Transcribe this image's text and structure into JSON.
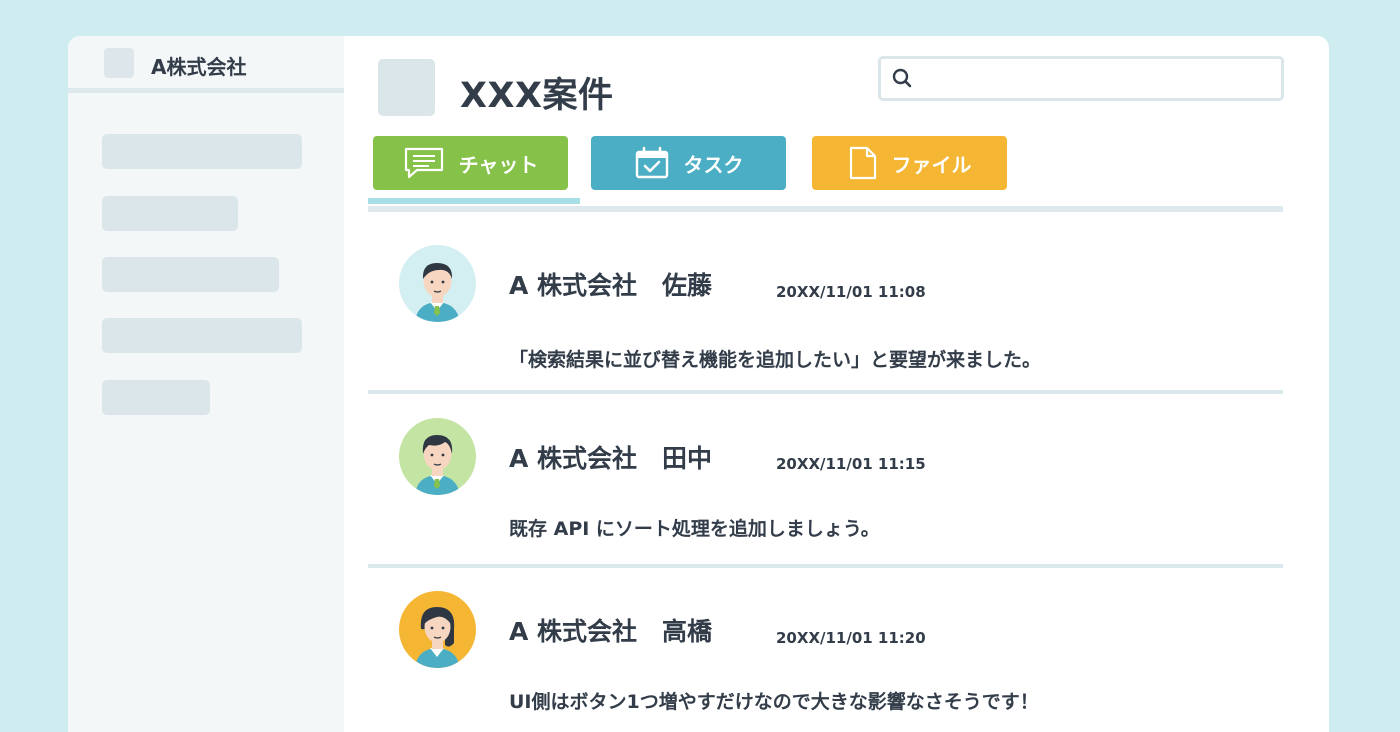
{
  "sidebar": {
    "org_name": "A株式会社",
    "nav_placeholders": 5
  },
  "main": {
    "title": "XXX案件",
    "search": {
      "value": "",
      "icon": "search-icon"
    }
  },
  "tabs": [
    {
      "label": "チャット",
      "icon": "chat-icon",
      "color": "#86c14a",
      "active": true
    },
    {
      "label": "タスク",
      "icon": "calendar-check-icon",
      "color": "#4caec4",
      "active": false
    },
    {
      "label": "ファイル",
      "icon": "file-icon",
      "color": "#f5b733",
      "active": false
    }
  ],
  "messages": [
    {
      "author": "A 株式会社　佐藤",
      "time": "20XX/11/01 11:08",
      "text": "「検索結果に並び替え機能を追加したい」と要望が来ました。",
      "avatar_bg": "#d4eff2"
    },
    {
      "author": "A 株式会社　田中",
      "time": "20XX/11/01 11:15",
      "text": "既存 API にソート処理を追加しましょう。",
      "avatar_bg": "#c3e4a2"
    },
    {
      "author": "A 株式会社　高橋",
      "time": "20XX/11/01 11:20",
      "text": "UI側はボタン1つ増やすだけなので大きな影響なさそうです！",
      "avatar_bg": "#f5b733"
    }
  ],
  "colors": {
    "background": "#cfedf0",
    "text": "#333d4a",
    "divider": "#dbe8ec",
    "active_tab_indicator": "#a8dfe6"
  }
}
